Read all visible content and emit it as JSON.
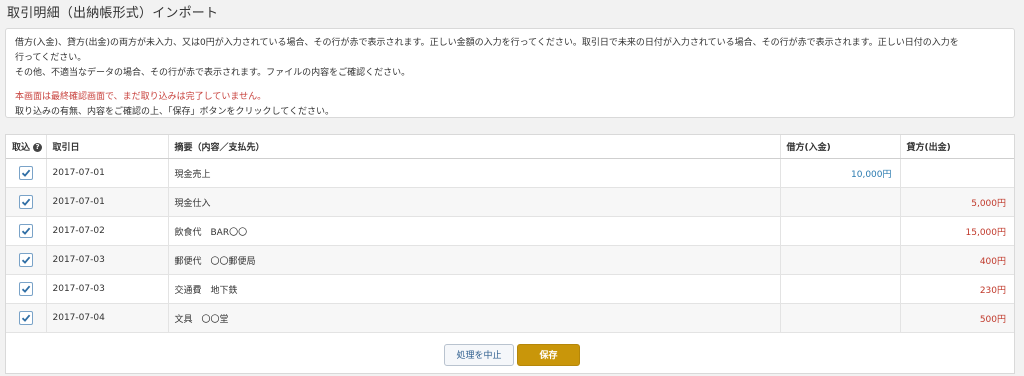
{
  "page": {
    "title": "取引明細（出納帳形式）インポート"
  },
  "notice": {
    "line1": "借方(入金)、貸方(出金)の両方が未入力、又は0円が入力されている場合、その行が赤で表示されます。正しい金額の入力を行ってください。取引日で未来の日付が入力されている場合、その行が赤で表示されます。正しい日付の入力を",
    "line2": "行ってください。",
    "line3": "その他、不適当なデータの場合、その行が赤で表示されます。ファイルの内容をご確認ください。",
    "warning": "本画面は最終確認画面で、まだ取り込みは完了していません。",
    "instruction": "取り込みの有無、内容をご確認の上、「保存」ボタンをクリックしてください。"
  },
  "table": {
    "headers": {
      "import": "取込",
      "date": "取引日",
      "description": "摘要（内容／支払先）",
      "debit": "借方(入金)",
      "credit": "貸方(出金)"
    },
    "rows": [
      {
        "checked": true,
        "date": "2017-07-01",
        "description": "現金売上",
        "debit": "10,000円",
        "credit": ""
      },
      {
        "checked": true,
        "date": "2017-07-01",
        "description": "現金仕入",
        "debit": "",
        "credit": "5,000円"
      },
      {
        "checked": true,
        "date": "2017-07-02",
        "description": "飲食代　BAR〇〇",
        "debit": "",
        "credit": "15,000円"
      },
      {
        "checked": true,
        "date": "2017-07-03",
        "description": "郵便代　〇〇郵便局",
        "debit": "",
        "credit": "400円"
      },
      {
        "checked": true,
        "date": "2017-07-03",
        "description": "交通費　地下鉄",
        "debit": "",
        "credit": "230円"
      },
      {
        "checked": true,
        "date": "2017-07-04",
        "description": "文具　〇〇堂",
        "debit": "",
        "credit": "500円"
      }
    ]
  },
  "actions": {
    "cancel_label": "処理を中止",
    "save_label": "保存"
  },
  "colors": {
    "accent": "#c9960a",
    "debit_text": "#2b7bb0",
    "credit_text": "#c0392b",
    "warning_text": "#c8423d"
  },
  "icons": {
    "help": "help-circle-icon",
    "check": "checkmark-icon"
  }
}
